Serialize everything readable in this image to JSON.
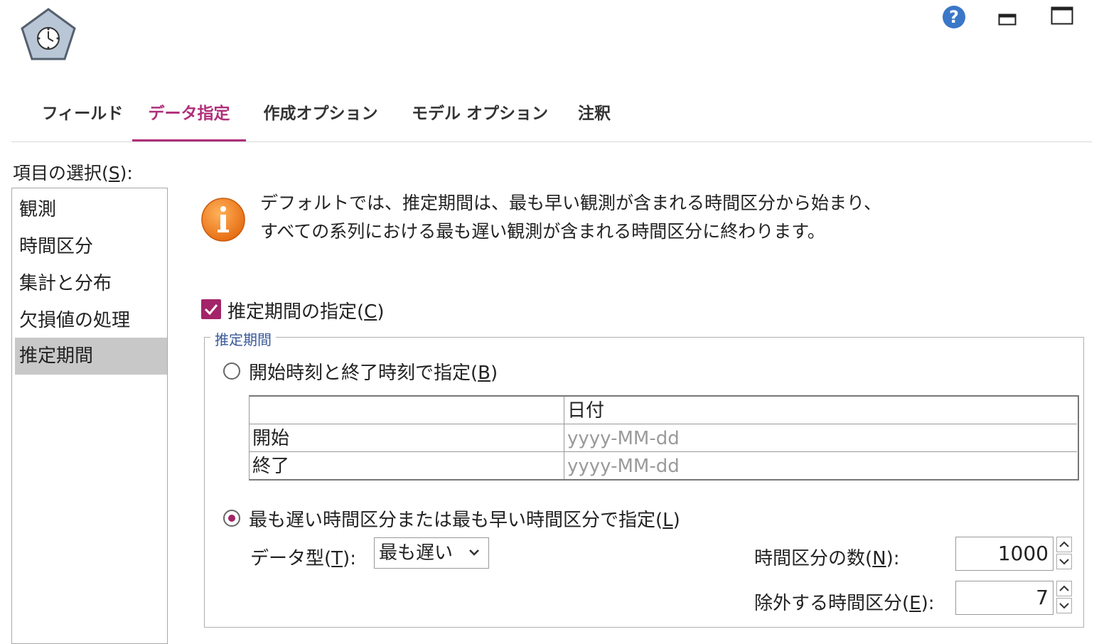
{
  "toolbar": {
    "node_icon": "time-series-node-icon",
    "help_icon": "help-icon",
    "restore_icon": "restore-window-icon",
    "maximize_icon": "maximize-window-icon"
  },
  "tabs": [
    {
      "label": "フィールド",
      "active": false
    },
    {
      "label": "データ指定",
      "active": true
    },
    {
      "label": "作成オプション",
      "active": false
    },
    {
      "label": "モデル オプション",
      "active": false
    },
    {
      "label": "注釈",
      "active": false
    }
  ],
  "sidebar": {
    "label_prefix": "項目の選択(",
    "label_key": "S",
    "label_suffix": "):",
    "items": [
      {
        "label": "観測",
        "selected": false
      },
      {
        "label": "時間区分",
        "selected": false
      },
      {
        "label": "集計と分布",
        "selected": false
      },
      {
        "label": "欠損値の処理",
        "selected": false
      },
      {
        "label": "推定期間",
        "selected": true
      }
    ]
  },
  "info": {
    "icon": "info-icon",
    "line1": "デフォルトでは、推定期間は、最も早い観測が含まれる時間区分から始まり、",
    "line2": "すべての系列における最も遅い観測が含まれる時間区分に終わります。"
  },
  "specify_period": {
    "checked": true,
    "label_prefix": "推定期間の指定(",
    "label_key": "C",
    "label_suffix": ")"
  },
  "period_group": {
    "legend": "推定期間",
    "option_start_end": {
      "selected": false,
      "label_prefix": "開始時刻と終了時刻で指定(",
      "label_key": "B",
      "label_suffix": ")"
    },
    "date_table": {
      "header_col1": "",
      "header_col2": "日付",
      "rows": [
        {
          "label": "開始",
          "placeholder": "yyyy-MM-dd"
        },
        {
          "label": "終了",
          "placeholder": "yyyy-MM-dd"
        }
      ]
    },
    "option_latest_earliest": {
      "selected": true,
      "label_prefix": "最も遅い時間区分または最も早い時間区分で指定(",
      "label_key": "L",
      "label_suffix": ")"
    },
    "datatype": {
      "label_prefix": "データ型(",
      "label_key": "T",
      "label_suffix": "):",
      "value": "最も遅い"
    },
    "num_periods": {
      "label_prefix": "時間区分の数(",
      "label_key": "N",
      "label_suffix": "):",
      "value": "1000"
    },
    "exclude_periods": {
      "label_prefix": "除外する時間区分(",
      "label_key": "E",
      "label_suffix": "):",
      "value": "7"
    }
  },
  "colors": {
    "accent": "#b0307a",
    "checkbox": "#a32468",
    "info_orange": "#e8771f",
    "help_blue": "#3a77c8"
  }
}
